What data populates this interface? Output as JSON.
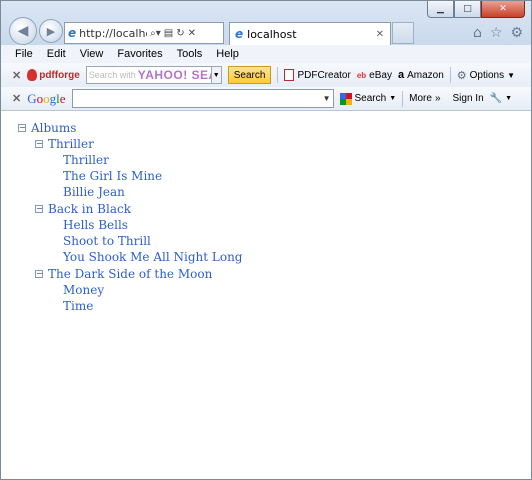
{
  "browser": {
    "address": "http://localhost/",
    "tab_title": "localhost"
  },
  "menu": [
    "File",
    "Edit",
    "View",
    "Favorites",
    "Tools",
    "Help"
  ],
  "toolbar1": {
    "brand": "pdfforge",
    "search_placeholder": "Search with",
    "search_brand": "YAHOO! SEARCH",
    "search_button": "Search",
    "pdfcreator": "PDFCreator",
    "ebay": "eBay",
    "amazon": "Amazon",
    "options": "Options"
  },
  "toolbar2": {
    "brand": "Google",
    "search_button": "Search",
    "more": "More",
    "sign_in": "Sign In"
  },
  "tree": {
    "root": "Albums",
    "albums": [
      {
        "title": "Thriller",
        "tracks": [
          "Thriller",
          "The Girl Is Mine",
          "Billie Jean"
        ]
      },
      {
        "title": "Back in Black",
        "tracks": [
          "Hells Bells",
          "Shoot to Thrill",
          "You Shook Me All Night Long"
        ]
      },
      {
        "title": "The Dark Side of the Moon",
        "tracks": [
          "Money",
          "Time"
        ]
      }
    ]
  }
}
